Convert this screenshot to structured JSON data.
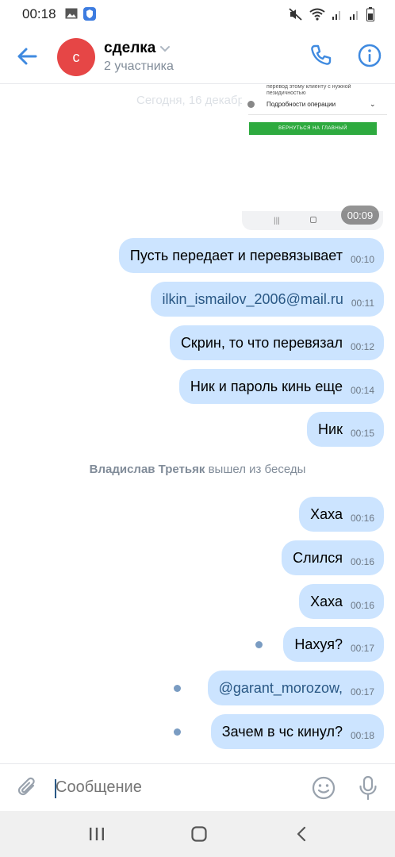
{
  "status_bar": {
    "time": "00:18",
    "icons": [
      "image-icon",
      "shield-icon",
      "mute-icon",
      "wifi-icon",
      "signal-icon",
      "signal-icon",
      "battery-icon"
    ]
  },
  "header": {
    "avatar_letter": "с",
    "avatar_color": "#e64646",
    "title": "сделка",
    "subtitle": "2 участника"
  },
  "date_label": "Сегодня, 16 декабря",
  "screenshot_attachment": {
    "text1": "перевод этому клиенту с нужной\nпезидичностью",
    "details_label": "Подробности операции",
    "button_label": "ВЕРНУТЬСЯ НА ГЛАВНЫЙ",
    "time": "00:09"
  },
  "messages": [
    {
      "text": "Пусть передает и перевязывает",
      "time": "00:10",
      "link": false
    },
    {
      "text": "ilkin_ismailov_2006@mail.ru",
      "time": "00:11",
      "link": true
    },
    {
      "text": "Скрин, то что перевязал",
      "time": "00:12",
      "link": false
    },
    {
      "text": "Ник и пароль кинь еще",
      "time": "00:14",
      "link": false
    },
    {
      "text": "Ник",
      "time": "00:15",
      "link": false
    }
  ],
  "system_message": {
    "name": "Владислав Третьяк",
    "action": "вышел из беседы"
  },
  "messages_after": [
    {
      "text": "Хаха",
      "time": "00:16",
      "link": false,
      "unread": false
    },
    {
      "text": "Слился",
      "time": "00:16",
      "link": false,
      "unread": false
    },
    {
      "text": "Хаха",
      "time": "00:16",
      "link": false,
      "unread": false
    },
    {
      "text": "Нахуя?",
      "time": "00:17",
      "link": false,
      "unread": true
    },
    {
      "text": "@garant_morozow,",
      "time": "00:17",
      "link": true,
      "unread": true
    },
    {
      "text": "Зачем в чс кинул?",
      "time": "00:18",
      "link": false,
      "unread": true
    }
  ],
  "composer": {
    "placeholder": "Сообщение"
  },
  "colors": {
    "accent": "#2a5885",
    "bubble": "#cce4ff",
    "link": "#2a5885"
  }
}
